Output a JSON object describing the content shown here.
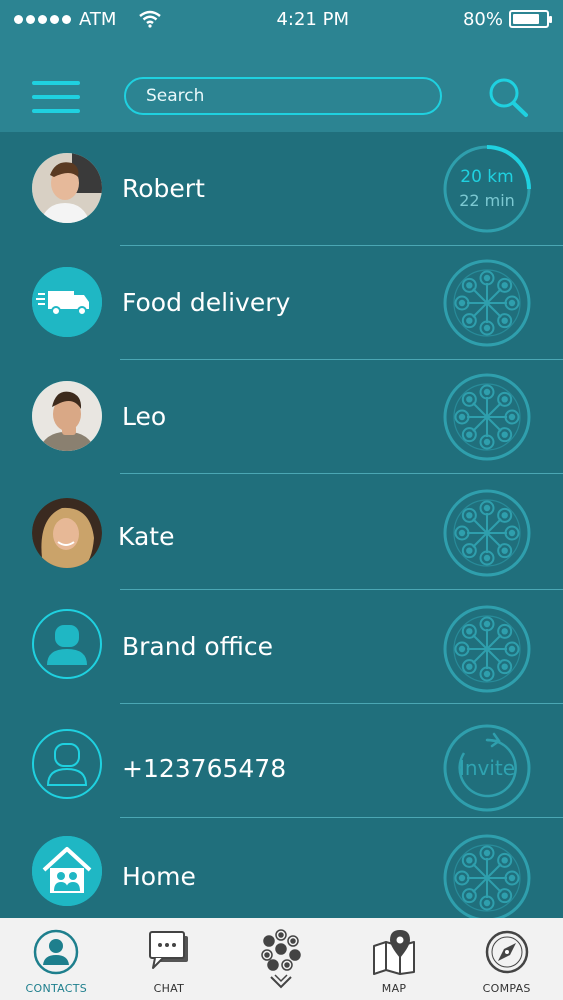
{
  "status": {
    "carrier": "ATM",
    "time": "4:21 PM",
    "battery": "80%",
    "battery_level": 0.8
  },
  "search": {
    "placeholder": "Search"
  },
  "contacts": [
    {
      "name": "Robert",
      "avatar": "photo",
      "distance": "20 km",
      "eta": "22 min"
    },
    {
      "name": "Food delivery",
      "avatar": "truck-icon"
    },
    {
      "name": "Leo",
      "avatar": "photo"
    },
    {
      "name": "Kate",
      "avatar": "photo"
    },
    {
      "name": "Brand office",
      "avatar": "person-icon"
    },
    {
      "name": "+123765478",
      "avatar": "person-outline-icon",
      "action": "Invite"
    },
    {
      "name": "Home",
      "avatar": "home-icon"
    }
  ],
  "nav": [
    {
      "label": "CONTACTS",
      "icon": "contacts-icon",
      "active": true
    },
    {
      "label": "CHAT",
      "icon": "chat-icon"
    },
    {
      "label": "",
      "icon": "app-logo-icon"
    },
    {
      "label": "MAP",
      "icon": "map-icon"
    },
    {
      "label": "COMPAS",
      "icon": "compass-icon"
    }
  ],
  "colors": {
    "accent": "#1fd1e0",
    "background": "#206f7c",
    "header": "#2c8492",
    "nav_bg": "#f2f2f2"
  }
}
